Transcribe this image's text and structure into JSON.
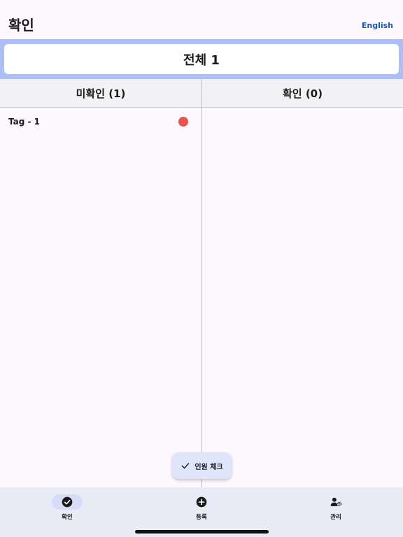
{
  "header": {
    "title": "확인",
    "language_link": "English"
  },
  "summary": {
    "total_label": "전체 1"
  },
  "columns": {
    "unconfirmed_label": "미확인 (1)",
    "confirmed_label": "확인 (0)"
  },
  "unconfirmed_items": [
    {
      "label": "Tag - 1",
      "status_color": "#e8534d"
    }
  ],
  "fab": {
    "label": "인원 체크",
    "icon": "check-icon"
  },
  "bottom_nav": {
    "items": [
      {
        "label": "확인",
        "icon": "check-circle-icon",
        "active": true
      },
      {
        "label": "등록",
        "icon": "add-circle-icon",
        "active": false
      },
      {
        "label": "관리",
        "icon": "manage-person-gear-icon",
        "active": false
      }
    ]
  },
  "colors": {
    "accent_band": "#aebff5",
    "link": "#1559b0",
    "nav_background": "#e9ecf7"
  }
}
